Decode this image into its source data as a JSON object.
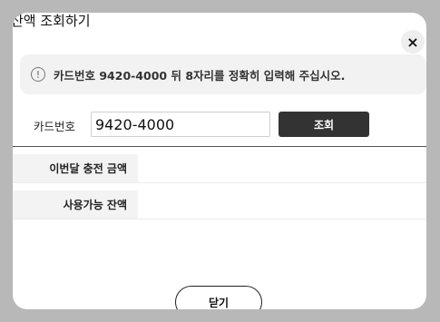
{
  "dialog": {
    "title": "잔액 조회하기",
    "close_icon": "×",
    "close_label": "닫기"
  },
  "notice": {
    "icon": "!",
    "text": "카드번호 9420-4000 뒤 8자리를 정확히 입력해 주십시오."
  },
  "form": {
    "card_label": "카드번호",
    "card_value": "9420-4000",
    "search_label": "조회"
  },
  "results": [
    {
      "label": "이번달 충전 금액",
      "value": ""
    },
    {
      "label": "사용가능 잔액",
      "value": ""
    }
  ]
}
